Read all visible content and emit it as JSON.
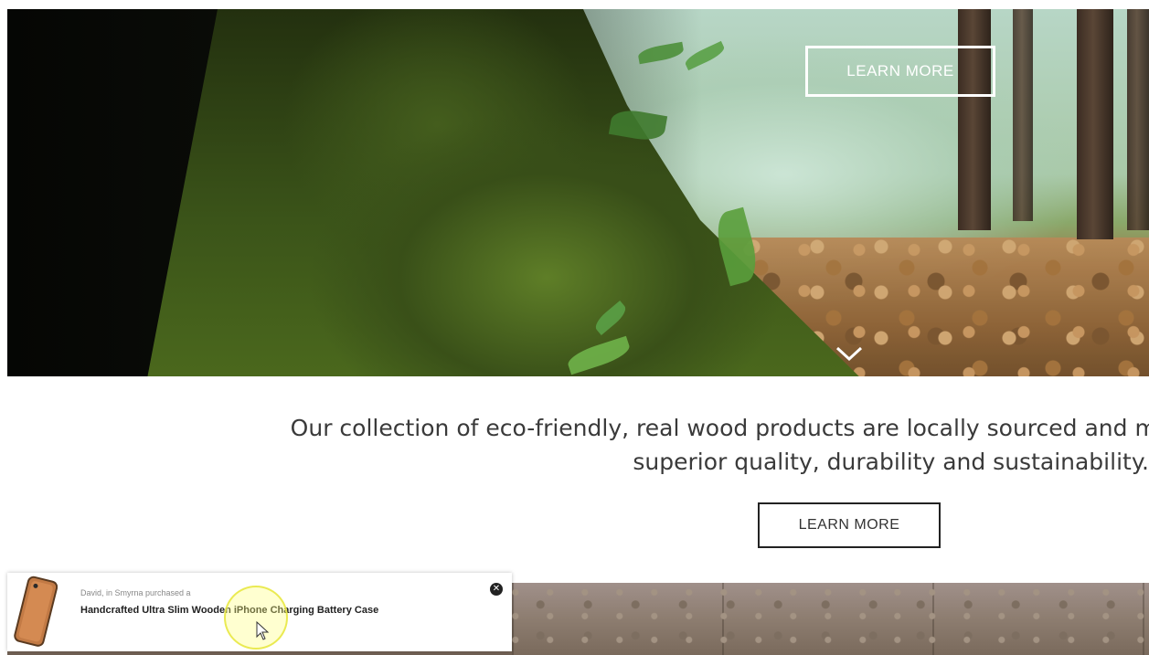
{
  "hero": {
    "learn_more_label": "LEARN MORE",
    "scroll_icon": "chevron-down-icon"
  },
  "intro": {
    "line1": "Our collection of eco-friendly, real wood products are locally sourced and mad",
    "line2": "superior quality, durability and sustainability.",
    "learn_more_label": "LEARN MORE"
  },
  "notification": {
    "buyer_text": "David, in Smyrna purchased a",
    "product_name": "Handcrafted Ultra Slim Wooden iPhone Charging Battery Case",
    "close_icon": "close-icon",
    "thumb_icon": "phone-case-thumbnail"
  },
  "colors": {
    "hero_button_border": "#ffffff",
    "intro_text": "#3a3a3a",
    "intro_button_border": "#222222",
    "popup_bg": "#ffffff",
    "cursor_highlight": "#f0f060"
  }
}
